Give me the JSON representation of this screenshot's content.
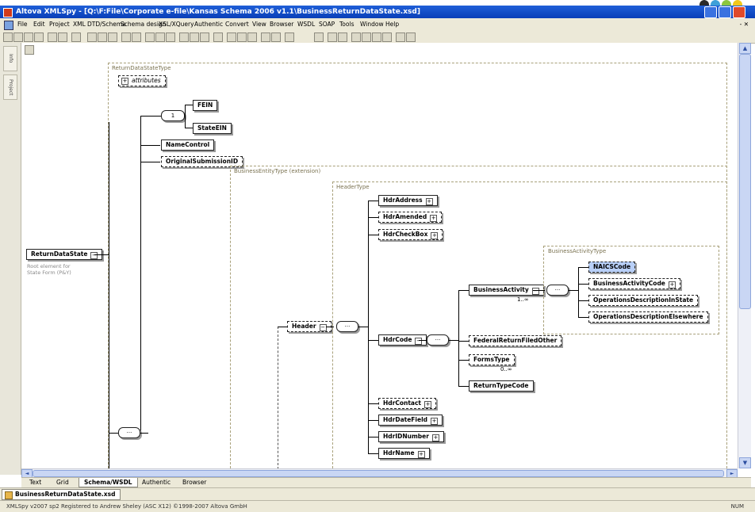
{
  "window": {
    "title": "Altova XMLSpy - [Q:\\F:File\\Corporate e-file\\Kansas Schema 2006 v1.1\\BusinessReturnDataState.xsd]"
  },
  "menu": [
    "File",
    "Edit",
    "Project",
    "XML",
    "DTD/Schema",
    "Schema design",
    "XSL/XQuery",
    "Authentic",
    "Convert",
    "View",
    "Browser",
    "WSDL",
    "SOAP",
    "Tools",
    "Window",
    "Help"
  ],
  "menu_mdi": "- ✕",
  "left_panel": {
    "tabs": [
      "Info",
      "Project"
    ]
  },
  "schema": {
    "root_element": "ReturnDataState",
    "root_annotation": "Root element for State Form (P&Y)",
    "root_type_label": "ReturnDataStateType",
    "attributes_label": "attributes",
    "choice_cardinality": "1",
    "choice_children": [
      "FEIN",
      "StateEIN"
    ],
    "name_control": "NameControl",
    "original_submission": "OriginalSubmissionID",
    "business_entity_label": "BusinessEntityType (extension)",
    "header_type_label": "HeaderType",
    "header_element": "Header",
    "hdr_top": [
      "HdrAddress",
      "HdrAmended",
      "HdrCheckBox"
    ],
    "hdr_code": "HdrCode",
    "hdr_bottom": [
      "HdrContact",
      "HdrDateField",
      "HdrIDNumber",
      "HdrName"
    ],
    "business_activity": "BusinessActivity",
    "business_activity_card": "1..∞",
    "business_activity_type_label": "BusinessActivityType",
    "ba_children": [
      "NAICSCode",
      "BusinessActivityCode",
      "OperationsDescriptionInState",
      "OperationsDescriptionElsewhere"
    ],
    "code_children": [
      "FederalReturnFiledOther",
      "FormsType",
      "ReturnTypeCode"
    ],
    "forms_type_card": "0..∞"
  },
  "view_tabs": [
    "Text",
    "Grid",
    "Schema/WSDL",
    "Authentic",
    "Browser"
  ],
  "active_view_tab": "Schema/WSDL",
  "document_tab": "BusinessReturnDataState.xsd",
  "status": {
    "left": "XMLSpy v2007 sp2  Registered to Andrew Sheley (ASC X12)  ©1998-2007 Altova GmbH",
    "right": "NUM"
  },
  "colors": {
    "titlebar": "#0a3fb8",
    "chrome": "#ece9d8",
    "selected": "#b8cff7"
  }
}
